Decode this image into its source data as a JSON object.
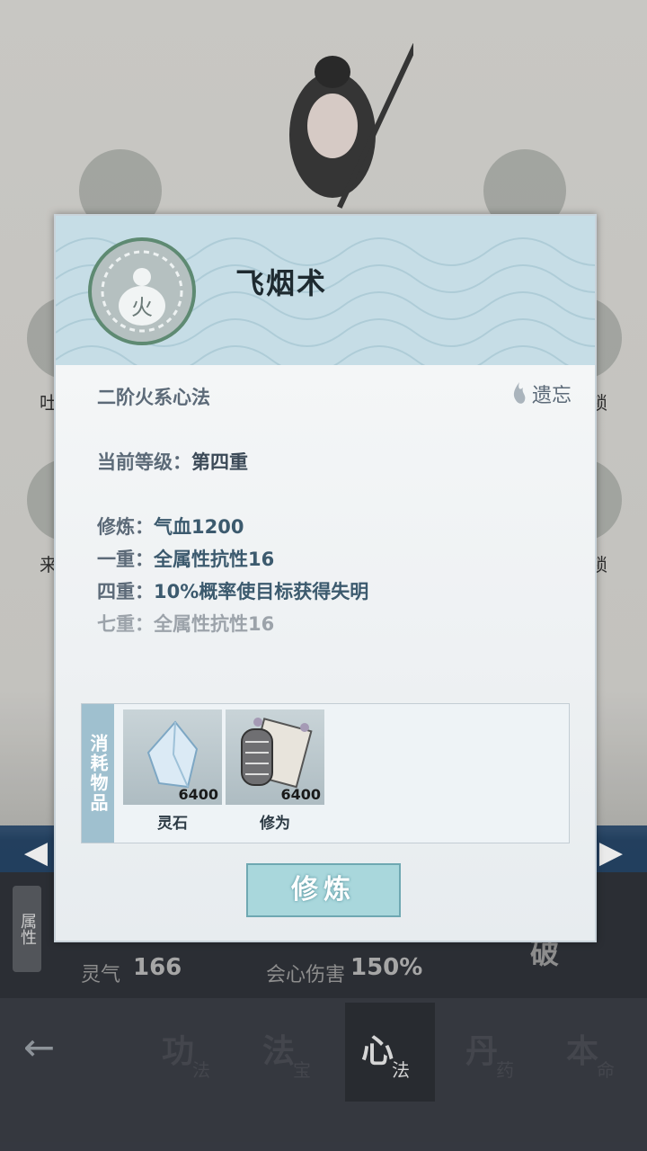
{
  "skill": {
    "title": "飞烟术",
    "icon_glyph": "火",
    "subtitle": "二阶火系心法",
    "forget_label": "遗忘"
  },
  "level": {
    "label": "当前等级：",
    "value": "第四重"
  },
  "effects": [
    {
      "key": "修炼：",
      "value": "气血1200",
      "active": true
    },
    {
      "key": "一重：",
      "value": "全属性抗性16",
      "active": true
    },
    {
      "key": "四重：",
      "value": "10%概率使目标获得失明",
      "active": true
    },
    {
      "key": "七重：",
      "value": "全属性抗性16",
      "active": false
    }
  ],
  "cost": {
    "tab_label": "消耗物品",
    "items": [
      {
        "name": "灵石",
        "count": "6400",
        "icon": "spirit-stone-icon"
      },
      {
        "name": "修为",
        "count": "6400",
        "icon": "scroll-icon"
      }
    ]
  },
  "train_button": "修炼",
  "background": {
    "side_labels": [
      "吐",
      "来",
      "锁",
      "锁"
    ],
    "stats": [
      {
        "label": "灵气",
        "value": "166"
      },
      {
        "label": "会心伤害",
        "value": "150%"
      }
    ],
    "attr_tab": "属性",
    "ghost_button": "破"
  },
  "nav": {
    "items": [
      {
        "big": "功",
        "small": "法"
      },
      {
        "big": "法",
        "small": "宝"
      },
      {
        "big": "心",
        "small": "法"
      },
      {
        "big": "丹",
        "small": "药"
      },
      {
        "big": "本",
        "small": "命"
      }
    ],
    "active_index": 2
  },
  "colors": {
    "header_bg": "#c6dde6",
    "button_bg": "#a9d7dc",
    "nav_bg": "#3a3d45"
  }
}
